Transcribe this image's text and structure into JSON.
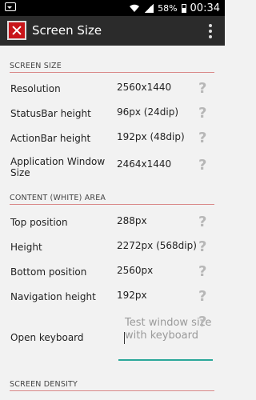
{
  "status_bar": {
    "battery": "58%",
    "time": "00:34"
  },
  "action_bar": {
    "title": "Screen Size"
  },
  "sections": {
    "screen_size": {
      "header": "SCREEN SIZE",
      "rows": [
        {
          "label": "Resolution",
          "value": "2560x1440"
        },
        {
          "label": "StatusBar height",
          "value": "96px (24dip)"
        },
        {
          "label": "ActionBar height",
          "value": "192px (48dip)"
        },
        {
          "label": "Application Window Size",
          "value": "2464x1440"
        }
      ]
    },
    "content_area": {
      "header": "CONTENT (WHITE) AREA",
      "rows": [
        {
          "label": "Top position",
          "value": "288px"
        },
        {
          "label": "Height",
          "value": "2272px (568dip)"
        },
        {
          "label": "Bottom position",
          "value": "2560px"
        },
        {
          "label": "Navigation height",
          "value": "192px"
        }
      ],
      "keyboard_label": "Open keyboard",
      "keyboard_placeholder": "Test window size with keyboard"
    },
    "screen_density": {
      "header": "SCREEN DENSITY"
    }
  },
  "help_icon": "?"
}
